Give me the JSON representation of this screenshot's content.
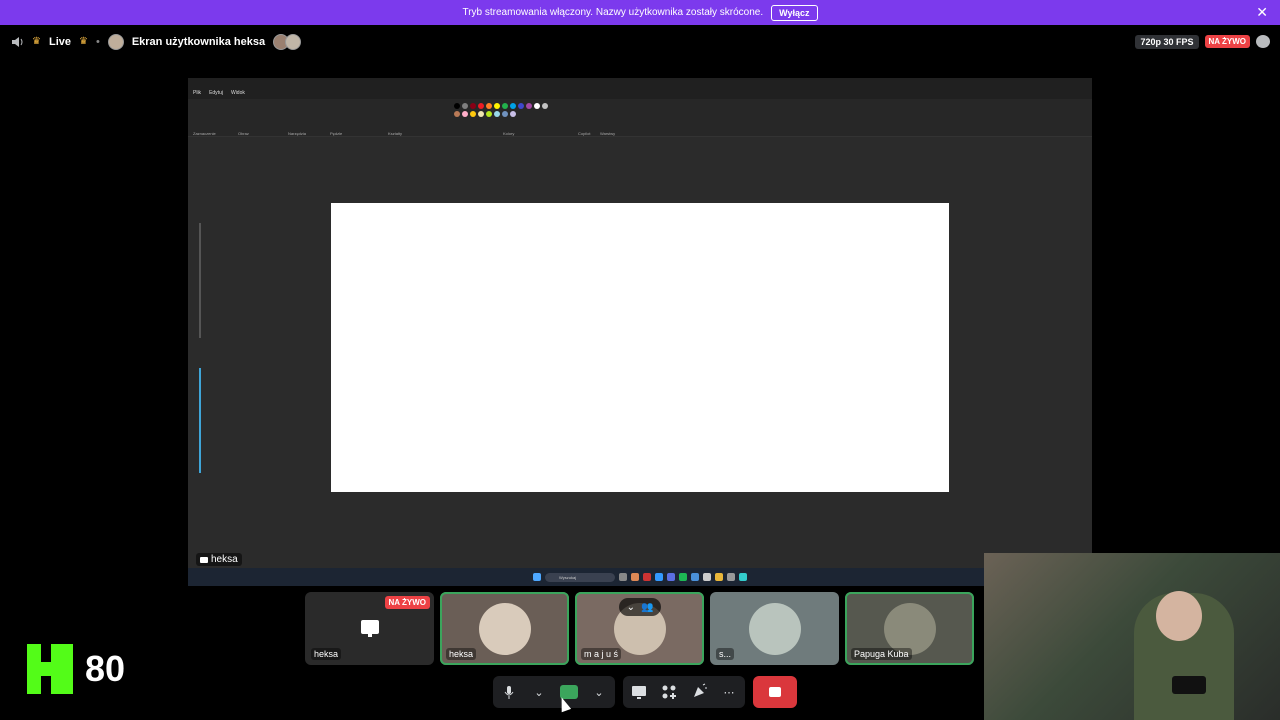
{
  "banner": {
    "text": "Tryb streamowania włączony. Nazwy użytkownika zostały skrócone.",
    "button": "Wyłącz",
    "close": "✕"
  },
  "topbar": {
    "live_label": "Live",
    "channel_title": "Ekran użytkownika heksa",
    "quality": "720p 30 FPS",
    "live_badge": "NA ŻYWO"
  },
  "screen_share": {
    "owner": "heksa",
    "app_menu": [
      "Plik",
      "Edytuj",
      "Widok"
    ],
    "ribbon_labels": [
      "Zaznaczenie",
      "Obraz",
      "Narzędzia",
      "Pędzle",
      "Kształty",
      "Kolory",
      "Copilot",
      "Warstwy"
    ],
    "search_placeholder": "Wyszukaj",
    "palette": [
      "#000000",
      "#7f7f7f",
      "#880015",
      "#ed1c24",
      "#ff7f27",
      "#fff200",
      "#22b14c",
      "#00a2e8",
      "#3f48cc",
      "#a349a4",
      "#ffffff",
      "#c3c3c3",
      "#b97a57",
      "#ffaec9",
      "#ffc90e",
      "#efe4b0",
      "#b5e61d",
      "#99d9ea",
      "#7092be",
      "#c8bfe7"
    ]
  },
  "participants": [
    {
      "name": "heksa",
      "live_badge": "NA ŻYWO",
      "type": "screen"
    },
    {
      "name": "heksa",
      "type": "camera"
    },
    {
      "name": "m a j u ś",
      "type": "camera"
    },
    {
      "name": "s...",
      "type": "camera"
    },
    {
      "name": "Papuga Kuba",
      "type": "camera"
    }
  ],
  "controls": {
    "mic": "mic-icon",
    "camera": "camera-icon",
    "share": "screen-share-icon",
    "activities": "activities-icon",
    "soundboard": "soundboard-icon",
    "more": "⋯",
    "disconnect": "disconnect-icon"
  },
  "kick": {
    "viewers": "80"
  },
  "colors": {
    "banner": "#7c3aed",
    "live": "#ed4245",
    "speaking": "#3ba55c",
    "kick": "#53fc18",
    "hangup": "#da373c"
  }
}
